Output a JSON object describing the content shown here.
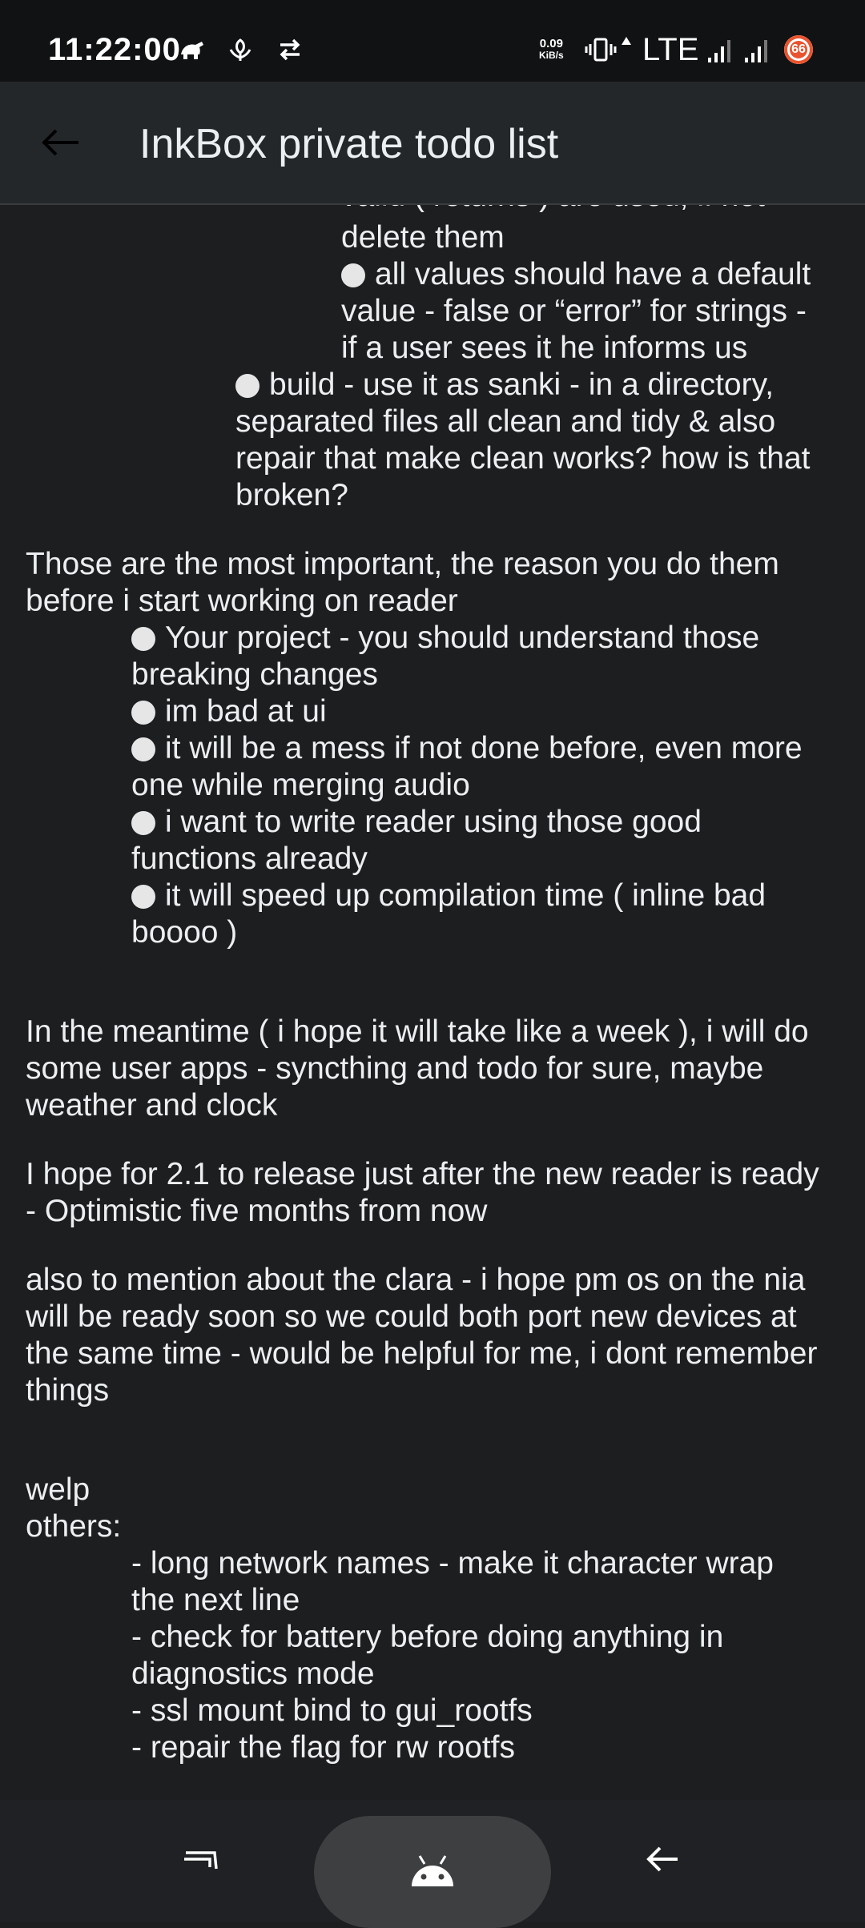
{
  "status_bar": {
    "time": "11:22:00",
    "speed_value": "0.09",
    "speed_unit": "KiB/s",
    "network": "LTE",
    "battery": "66",
    "icons": [
      "turtle-icon",
      "leaf-icon",
      "sync-icon",
      "vibrate-icon",
      "signal-icon",
      "signal-icon-2"
    ]
  },
  "app_bar": {
    "title": "InkBox private todo list",
    "back_icon": "arrow-left-icon"
  },
  "content": {
    "cut_line": "valid ( returns ) are used, if not",
    "l1": "delete them",
    "l2": "all values should have a default",
    "l3": "value - false or “error” for strings -",
    "l4": "if a user sees it he informs us",
    "l5": "build - use it as sanki - in a directory,",
    "l6": "separated files all clean and tidy & also",
    "l7": "repair that make clean works? how is that",
    "l8": "broken?",
    "p1a": "Those are the most important, the reason you do them",
    "p1b": "before i start working on reader",
    "b1a": "Your project - you should understand those",
    "b1b": "breaking changes",
    "b2": "im bad at ui",
    "b3a": "it will be a mess if not done before, even more",
    "b3b": "one while merging audio",
    "b4a": "i want to write reader using those good",
    "b4b": "functions already",
    "b5a": "it will speed up compilation time ( inline bad",
    "b5b": "boooo )",
    "p2a": "In the meantime ( i hope it will take like a week ), i will do",
    "p2b": "some user apps - syncthing and todo for sure, maybe",
    "p2c": "weather and clock",
    "p3a": "I hope for 2.1 to release just after the new reader is ready",
    "p3b": "- Optimistic five months from now",
    "p4a": "also to mention about the clara - i hope pm os on the nia",
    "p4b": "will be ready soon so we could both port new devices at",
    "p4c": "the same time - would be helpful for me, i dont remember",
    "p4d": "things",
    "welp": "welp",
    "others": "others:",
    "o1a": "- long network names - make it character wrap",
    "o1b": "the next line",
    "o2a": "- check for battery before doing anything in",
    "o2b": "diagnostics mode",
    "o3": "- ssl mount bind to gui_rootfs",
    "o4": "- repair the flag for rw rootfs"
  },
  "nav_bar": {
    "recents_icon": "recents-icon",
    "home_icon": "android-icon",
    "back_icon": "back-arrow-icon"
  }
}
